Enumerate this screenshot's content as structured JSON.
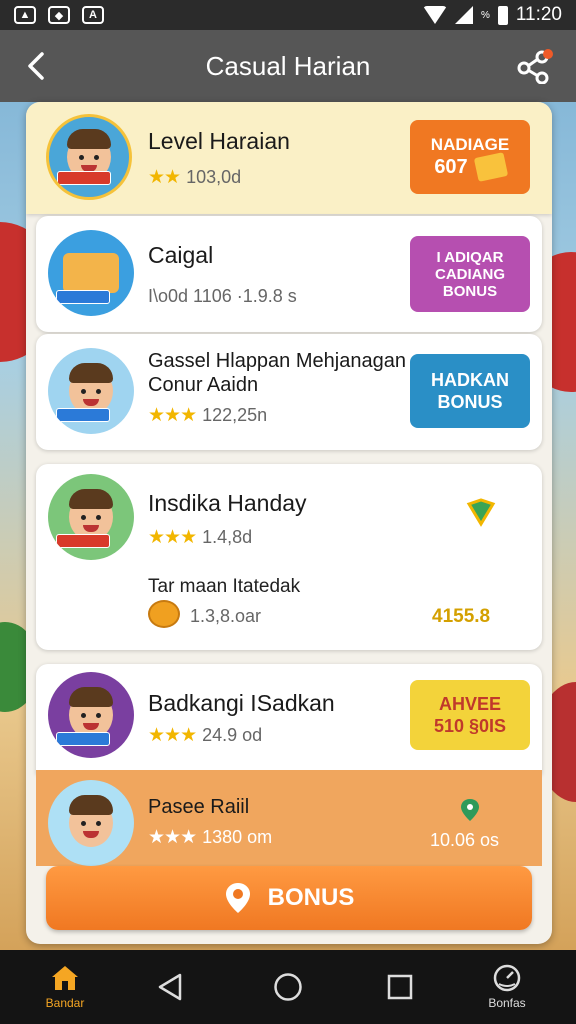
{
  "status_bar": {
    "time": "11:20",
    "battery_pct": "%"
  },
  "header": {
    "title": "Casual Harian"
  },
  "colors": {
    "orange": "#f07822",
    "magenta": "#b64fb0",
    "teal": "#2a8fc6",
    "yellow": "#f3d33a",
    "star": "#f2b600",
    "header": "#565656"
  },
  "cards": [
    {
      "name": "Level Haraian",
      "rating": "103,0d",
      "button": {
        "line1": "NADIAGE",
        "line2": "607"
      }
    },
    {
      "name": "Caigal",
      "sub": "I\\o0d 1106 ·1.9.8 s",
      "button": {
        "line1": "I ADIQAR",
        "line2": "CADIANG",
        "line3": "BONUS"
      }
    },
    {
      "name_line1": "Gassel Hlappan Mehjanagan",
      "name_line2": "Conur Aaidn",
      "rating": "122,25n",
      "button": {
        "line1": "HADKAN",
        "line2": "BONUS"
      }
    },
    {
      "name": "Insdika Handay",
      "rating": "1.4,8d",
      "sub_label": "Tar maan Itatedak",
      "coin_value": "1.3,8.oar",
      "amount": "4155.8"
    },
    {
      "name": "Badkangi ISadkan",
      "rating": "24.9 od",
      "button": {
        "line1": "AHVEE",
        "line2": "510 §0IS"
      }
    },
    {
      "name": "Pasee Raiil",
      "rating": "1380 om",
      "amount": "10.06 os"
    }
  ],
  "bottom_button": {
    "label": "BONUS"
  },
  "nav": [
    {
      "label": "Bandar",
      "icon": "home-icon"
    },
    {
      "label": "",
      "icon": "back-triangle-icon"
    },
    {
      "label": "",
      "icon": "home-circle-icon"
    },
    {
      "label": "",
      "icon": "recents-square-icon"
    },
    {
      "label": "Bonfas",
      "icon": "gauge-icon"
    }
  ]
}
